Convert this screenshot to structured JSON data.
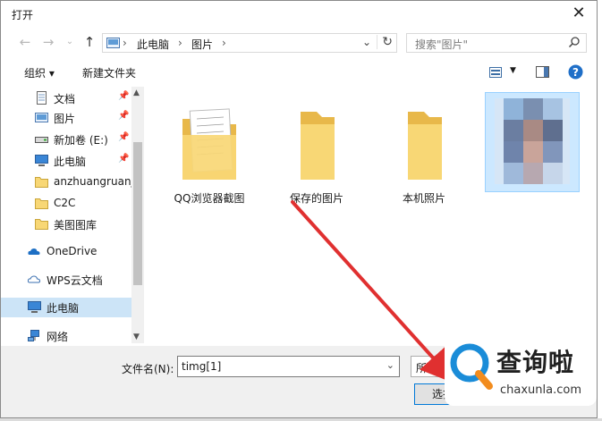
{
  "window": {
    "title": "打开",
    "close_glyph": "✕"
  },
  "navigation": {
    "address_crumbs": [
      "此电脑",
      "图片"
    ],
    "search_placeholder": "搜索\"图片\""
  },
  "toolbar": {
    "organize_label": "组织 ▾",
    "new_folder_label": "新建文件夹"
  },
  "sidebar": {
    "items": [
      {
        "label": "文档",
        "icon": "document-icon",
        "pinned": true
      },
      {
        "label": "图片",
        "icon": "pictures-icon",
        "pinned": true
      },
      {
        "label": "新加卷 (E:)",
        "icon": "drive-icon",
        "pinned": true
      },
      {
        "label": "此电脑",
        "icon": "pc-icon",
        "pinned": true
      },
      {
        "label": "anzhuangruanj",
        "icon": "folder-icon",
        "pinned": false
      },
      {
        "label": "C2C",
        "icon": "folder-icon",
        "pinned": false
      },
      {
        "label": "美图图库",
        "icon": "folder-icon",
        "pinned": false
      },
      {
        "label": "OneDrive",
        "icon": "onedrive-icon",
        "pinned": false
      },
      {
        "label": "WPS云文档",
        "icon": "cloud-icon",
        "pinned": false
      },
      {
        "label": "此电脑",
        "icon": "pc-icon",
        "pinned": false,
        "selected": true
      },
      {
        "label": "网络",
        "icon": "network-icon",
        "pinned": false
      }
    ]
  },
  "files": [
    {
      "label": "QQ浏览器截图",
      "type": "folder-with-docs"
    },
    {
      "label": "保存的图片",
      "type": "folder"
    },
    {
      "label": "本机照片",
      "type": "folder"
    },
    {
      "label": "",
      "type": "image-thumbnail",
      "selected": true
    }
  ],
  "bottom": {
    "filename_label": "文件名(N):",
    "filename_value": "timg[1]",
    "filetype_value": "所有",
    "open_button": "选择",
    "cancel_button": ""
  },
  "watermark": {
    "brand": "查询啦",
    "domain": "chaxunla.com"
  },
  "colors": {
    "accent": "#0078d7",
    "arrow": "#e03030",
    "folder": "#f8d775",
    "selection": "#cce8ff"
  }
}
